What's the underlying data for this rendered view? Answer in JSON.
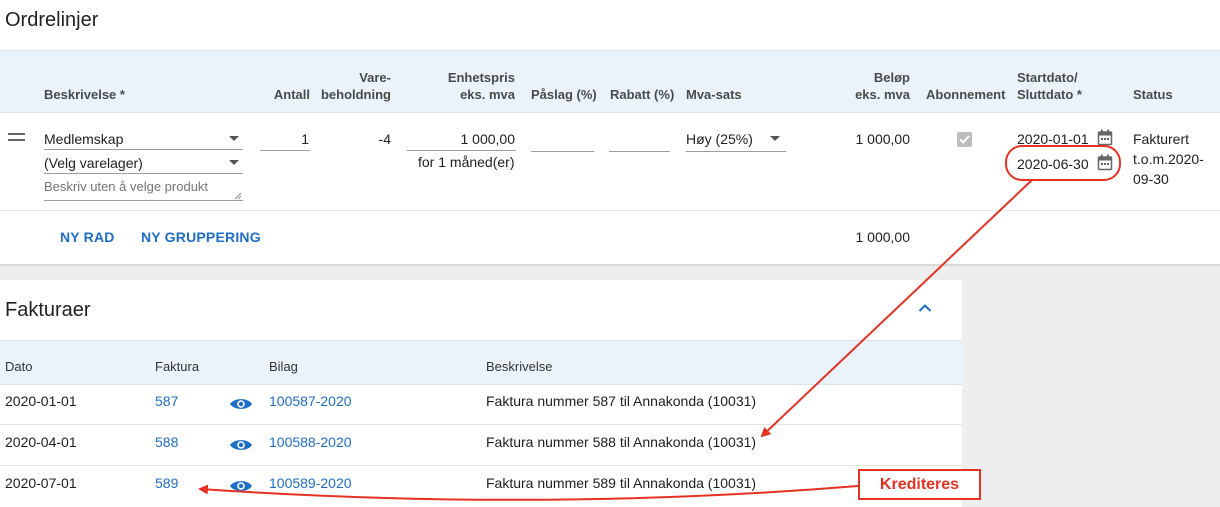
{
  "orderlines": {
    "title": "Ordrelinjer",
    "headers": {
      "beskrivelse": "Beskrivelse *",
      "antall": "Antall",
      "vare_1": "Vare-",
      "vare_2": "beholdning",
      "enhetspris_1": "Enhetspris",
      "enhetspris_2": "eks. mva",
      "paslag": "Påslag (%)",
      "rabatt": "Rabatt (%)",
      "mva": "Mva-sats",
      "belop_1": "Beløp",
      "belop_2": "eks. mva",
      "abonnement": "Abonnement",
      "dato_1": "Startdato/",
      "dato_2": "Sluttdato *",
      "status": "Status"
    },
    "row": {
      "product": "Medlemskap",
      "warehouse": "(Velg varelager)",
      "description_placeholder": "Beskriv uten å velge produkt",
      "quantity": "1",
      "stock": "-4",
      "unit_price": "1 000,00",
      "period": "for 1 måned(er)",
      "vat": "Høy (25%)",
      "amount": "1 000,00",
      "subscription_checked": true,
      "start_date": "2020-01-01",
      "end_date": "2020-06-30",
      "status_1": "Fakturert",
      "status_2": "t.o.m.2020-",
      "status_3": "09-30"
    },
    "actions": {
      "new_row": "NY RAD",
      "new_group": "NY GRUPPERING"
    },
    "total": "1 000,00"
  },
  "invoices": {
    "title": "Fakturaer",
    "headers": {
      "dato": "Dato",
      "faktura": "Faktura",
      "bilag": "Bilag",
      "beskrivelse": "Beskrivelse"
    },
    "rows": [
      {
        "date": "2020-01-01",
        "invoice": "587",
        "voucher": "100587-2020",
        "description": "Faktura nummer 587 til Annakonda (10031)"
      },
      {
        "date": "2020-04-01",
        "invoice": "588",
        "voucher": "100588-2020",
        "description": "Faktura nummer 588 til Annakonda (10031)"
      },
      {
        "date": "2020-07-01",
        "invoice": "589",
        "voucher": "100589-2020",
        "description": "Faktura nummer 589 til Annakonda (10031)"
      }
    ]
  },
  "annotation": {
    "label": "Krediteres",
    "color": "#e53222"
  },
  "colors": {
    "link": "#1e6ec8",
    "header_bg": "#eaf3fb"
  }
}
